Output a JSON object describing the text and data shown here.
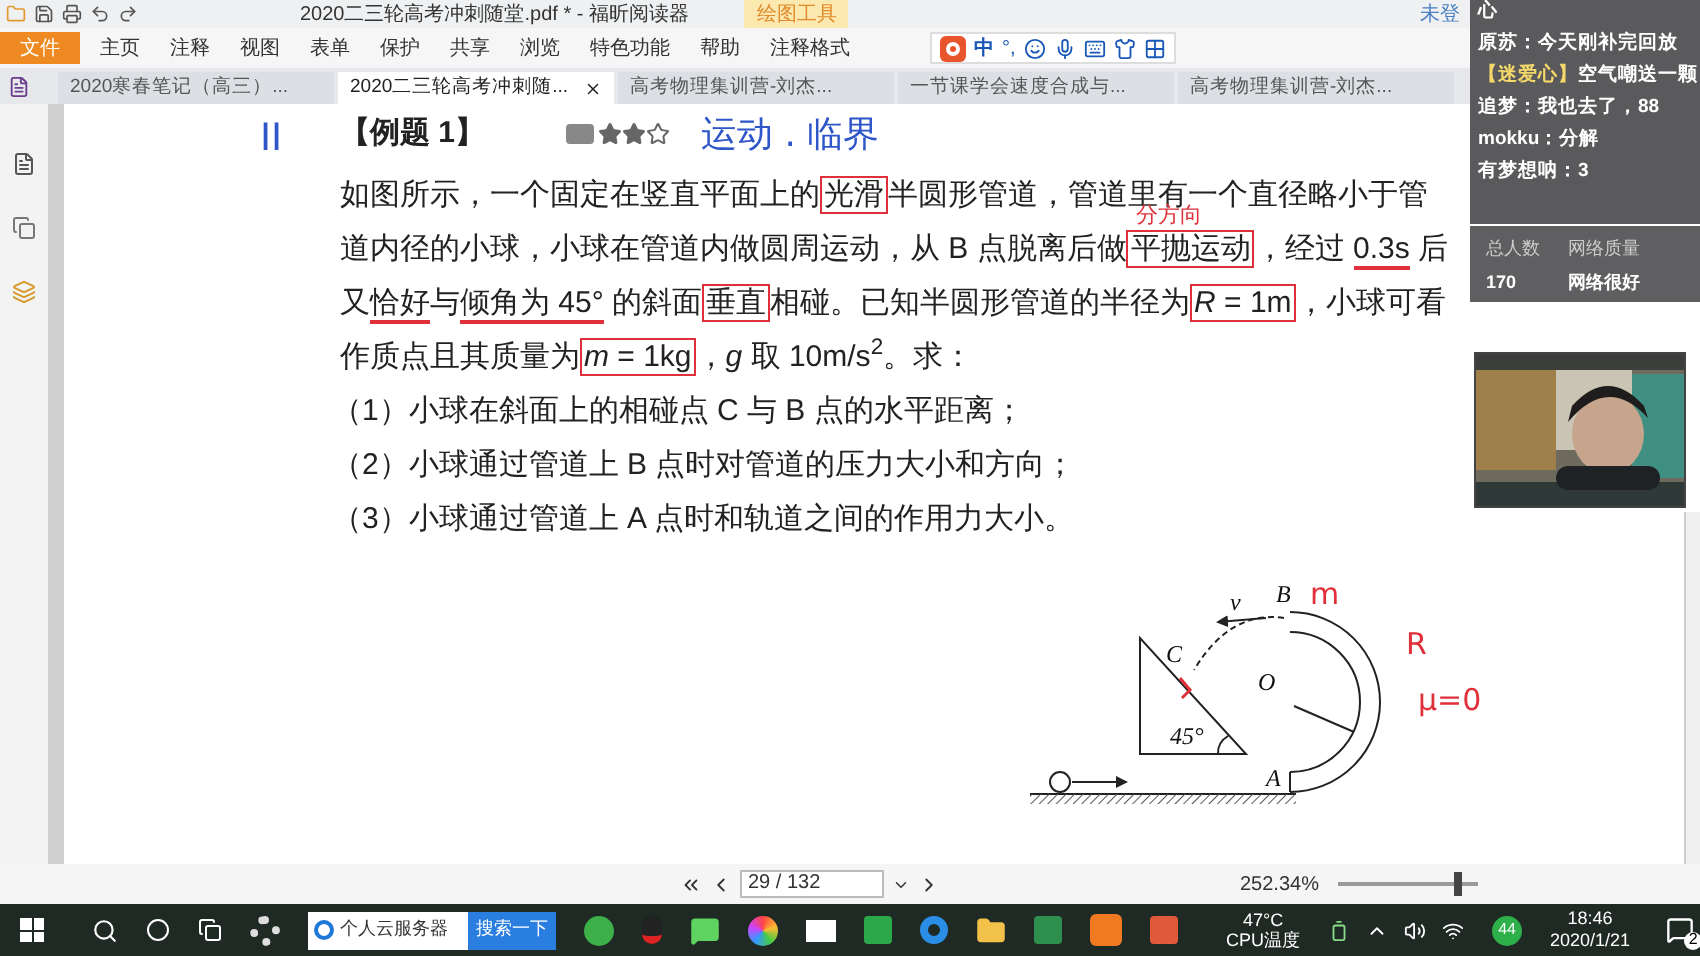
{
  "title_bar": {
    "title": "2020二三轮高考冲刺随堂.pdf * - 福昕阅读器",
    "context_tab": "绘图工具",
    "account": "未登"
  },
  "ribbon": {
    "file": "文件",
    "menus": [
      "主页",
      "注释",
      "视图",
      "表单",
      "保护",
      "共享",
      "浏览",
      "特色功能",
      "帮助",
      "注释格式"
    ]
  },
  "ime": {
    "mode": "中",
    "punct": "°,"
  },
  "tabs": [
    {
      "label": "2020寒春笔记（高三）...",
      "selected": false
    },
    {
      "label": "2020二三轮高考冲刺随...",
      "selected": true
    },
    {
      "label": "高考物理集训营-刘杰...",
      "selected": false
    },
    {
      "label": "一节课学会速度合成与...",
      "selected": false
    },
    {
      "label": "高考物理集训营-刘杰...",
      "selected": false
    }
  ],
  "chat": {
    "messages": [
      {
        "text": "心"
      },
      {
        "user": "原苏：",
        "text": "今天刚补完回放"
      },
      {
        "user": "【迷爱心】",
        "text": "空气嘲送一颗"
      },
      {
        "user": "追梦：",
        "text": "我也去了，88"
      },
      {
        "user": "mokku：",
        "text": "分解"
      },
      {
        "user": "有梦想呐：",
        "text": "3"
      }
    ],
    "stats": [
      {
        "label": "总人数",
        "value": "170"
      },
      {
        "label": "网络质量",
        "value": "网络很好"
      }
    ]
  },
  "document": {
    "annotations": [
      {
        "text": "II",
        "color": "#2f56c8"
      },
      {
        "text": "运动 . 临界",
        "color": "#2f56c8"
      },
      {
        "text": "分方向",
        "color": "#e0303a"
      }
    ],
    "heading": "【例题 1】",
    "stars": 2,
    "lines": [
      {
        "segments": [
          {
            "text": "如图所示，一个固定在竖直平面上的",
            "kind": "plain"
          },
          {
            "text": "光滑",
            "kind": "box"
          },
          {
            "text": "半圆形管道，管道里有一个直径略小于管",
            "kind": "plain"
          }
        ]
      },
      {
        "segments": [
          {
            "text": "道内径的小球，小球在管道内做圆周运动，从 B 点脱离后做",
            "kind": "plain"
          },
          {
            "text": "平抛运动",
            "kind": "box"
          },
          {
            "text": "，经过 ",
            "kind": "plain"
          },
          {
            "text": "0.3s",
            "kind": "underline"
          },
          {
            "text": " 后",
            "kind": "plain"
          }
        ]
      },
      {
        "segments": [
          {
            "text": "又",
            "kind": "plain"
          },
          {
            "text": "恰好",
            "kind": "underline"
          },
          {
            "text": "与",
            "kind": "plain"
          },
          {
            "text": "倾角为 45°",
            "kind": "underline"
          },
          {
            "text": " 的斜面",
            "kind": "plain"
          },
          {
            "text": "垂直",
            "kind": "box"
          },
          {
            "text": "相碰。已知半圆形管道的半径为",
            "kind": "plain"
          },
          {
            "text": "*R* = 1m",
            "kind": "box"
          },
          {
            "text": "，小球可看",
            "kind": "plain"
          }
        ]
      },
      {
        "segments": [
          {
            "text": "作质点且其质量为",
            "kind": "plain"
          },
          {
            "text": "*m* = 1kg",
            "kind": "box"
          },
          {
            "text": "，*g* 取 10m/s$^{2}$。求：",
            "kind": "plain"
          }
        ]
      }
    ],
    "questions": [
      "（1）小球在斜面上的相碰点 C 与 B 点的水平距离；",
      "（2）小球通过管道上 B 点时对管道的压力大小和方向；",
      "（3）小球通过管道上 A 点时和轨道之间的作用力大小。"
    ],
    "diagram_labels": [
      {
        "text": "B",
        "kind": "label"
      },
      {
        "text": "C",
        "kind": "label"
      },
      {
        "text": "O",
        "kind": "label"
      },
      {
        "text": "A",
        "kind": "label"
      },
      {
        "text": "v",
        "kind": "label"
      },
      {
        "text": "45°",
        "kind": "label"
      },
      {
        "text": "m",
        "kind": "note"
      },
      {
        "text": "R",
        "kind": "note"
      },
      {
        "text": "μ=0",
        "kind": "note"
      }
    ]
  },
  "status_bar": {
    "page": "29 / 132",
    "zoom": "252.34%",
    "zoom_slider": {
      "level": 0.85
    }
  },
  "taskbar": {
    "search_text": "个人云服务器",
    "search_button": "搜索一下",
    "temperature": "47°C",
    "temperature_label": "CPU温度",
    "badge": "44",
    "time": "18:46",
    "date": "2020/1/21",
    "notifications": "2"
  }
}
